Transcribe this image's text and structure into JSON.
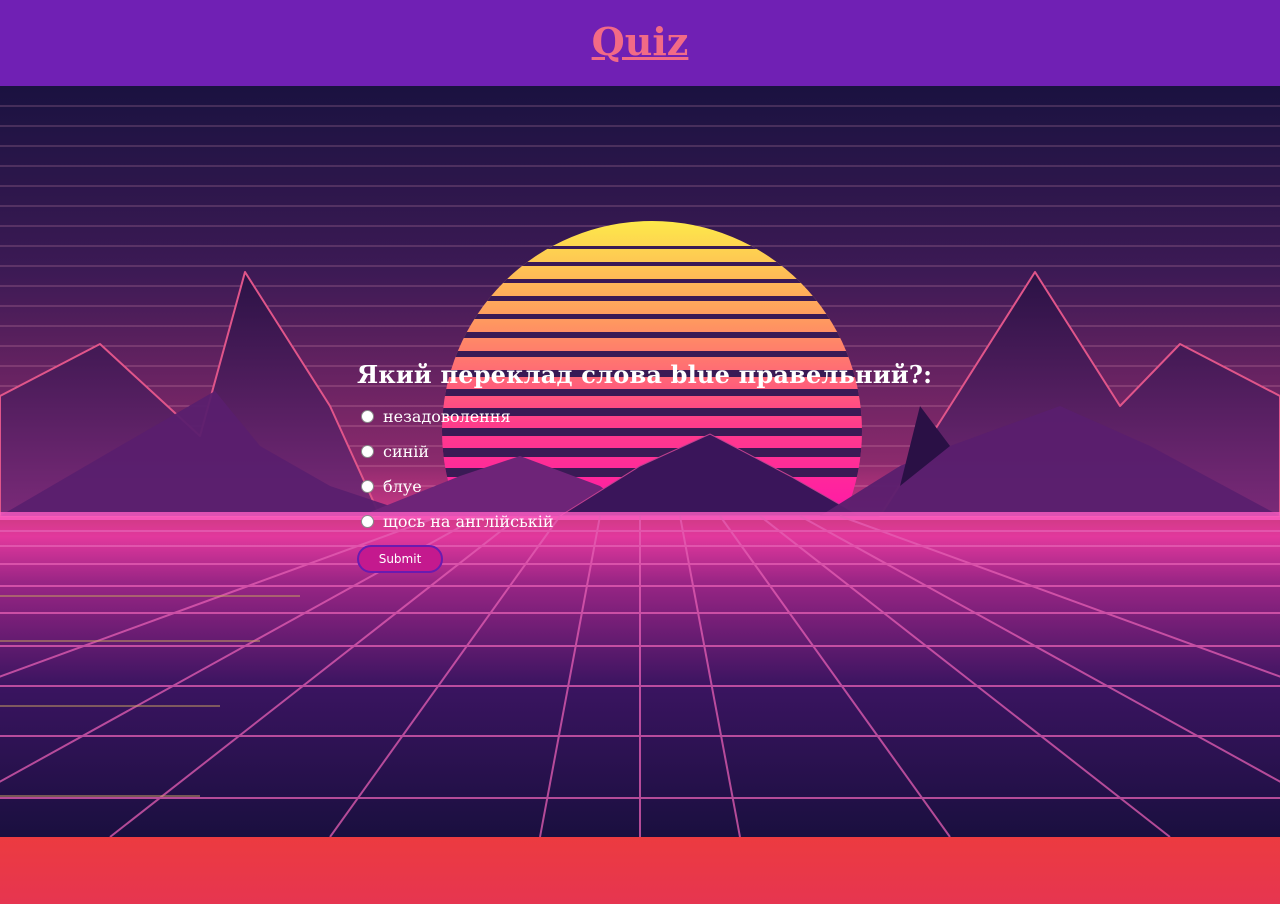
{
  "header": {
    "title": "Quiz",
    "bg_color": "#7020b4",
    "title_color": "#f26a86"
  },
  "hero": {
    "background": "synthwave-sunset-mountains-grid"
  },
  "quiz": {
    "question": "Який переклад слова blue правельний?:",
    "options": [
      {
        "label": "незадоволення",
        "selected": false
      },
      {
        "label": "синій",
        "selected": false
      },
      {
        "label": "блуе",
        "selected": false
      },
      {
        "label": "щось на англійській",
        "selected": false
      }
    ],
    "submit_label": "Submit",
    "submit_color": "#c4198e"
  },
  "footer": {
    "bg_color": "#ea3a46"
  }
}
